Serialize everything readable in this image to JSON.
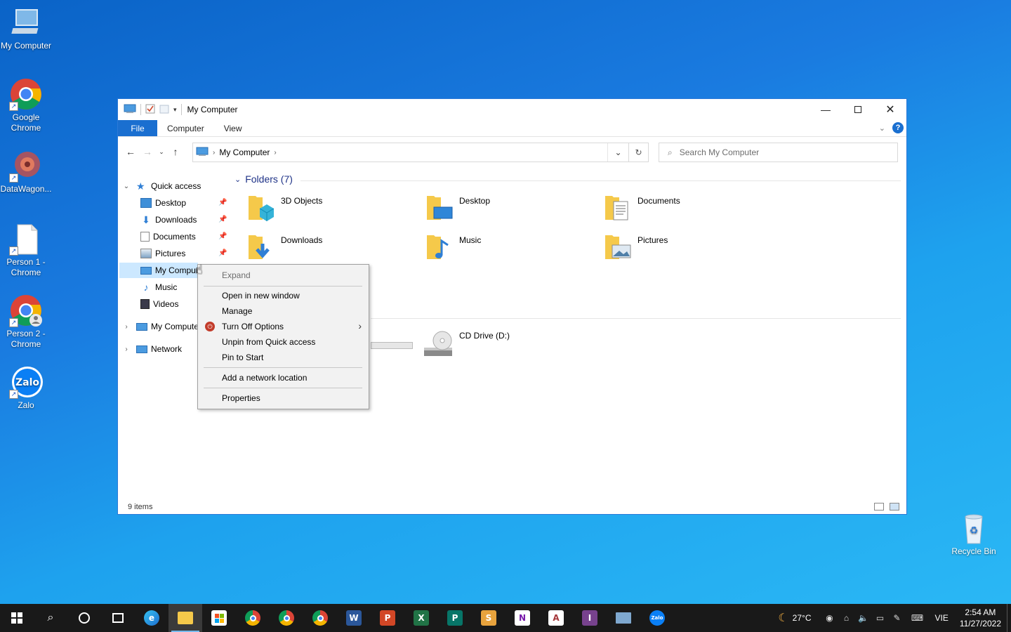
{
  "desktop": {
    "icons": [
      {
        "label": "My Computer"
      },
      {
        "label": "Google Chrome"
      },
      {
        "label": "DataWagon..."
      },
      {
        "label": "Person 1 - Chrome"
      },
      {
        "label": "Person 2 - Chrome"
      },
      {
        "label": "Zalo"
      },
      {
        "label": "Recycle Bin"
      }
    ]
  },
  "window": {
    "title": "My Computer",
    "ribbon_tabs": [
      "File",
      "Computer",
      "View"
    ],
    "address": {
      "path": [
        "My Computer"
      ]
    },
    "search": {
      "placeholder": "Search My Computer"
    },
    "nav": {
      "quick_access": "Quick access",
      "items": [
        "Desktop",
        "Downloads",
        "Documents",
        "Pictures",
        "My Computer",
        "Music",
        "Videos"
      ],
      "my_computer": "My Computer",
      "network": "Network"
    },
    "content": {
      "folders_header": "Folders (7)",
      "folders": [
        "3D Objects",
        "Desktop",
        "Documents",
        "Downloads",
        "Music",
        "Pictures"
      ],
      "drive": "CD Drive (D:)"
    },
    "status": "9 items"
  },
  "context_menu": {
    "items": [
      "Expand",
      "Open in new window",
      "Manage",
      "Turn Off Options",
      "Unpin from Quick access",
      "Pin to Start",
      "Add a network location",
      "Properties"
    ]
  },
  "taskbar": {
    "weather": "27°C",
    "language": "VIE",
    "time": "2:54 AM",
    "date": "11/27/2022"
  },
  "colors": {
    "accent": "#1a6fd0",
    "folder": "#f5c94a",
    "selection": "#cce8ff"
  }
}
